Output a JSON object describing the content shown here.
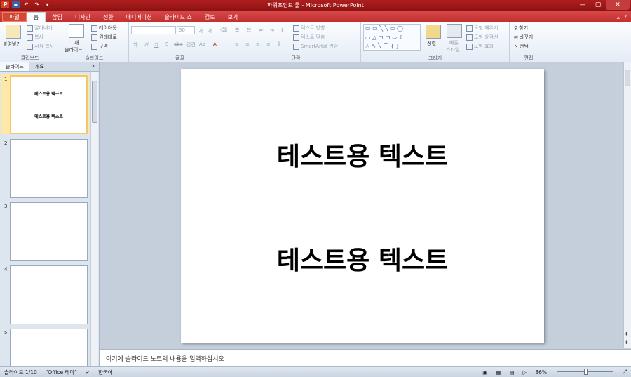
{
  "titlebar": {
    "title": "파워포인트 툴 - Microsoft PowerPoint",
    "qat": [
      "ppt-icon",
      "save-icon",
      "undo-icon",
      "redo-icon",
      "customize-icon"
    ]
  },
  "tabs": [
    "파일",
    "홈",
    "삽입",
    "디자인",
    "전환",
    "애니메이션",
    "슬라이드 쇼",
    "검토",
    "보기"
  ],
  "active_tab": "홈",
  "ribbon": {
    "clipboard": {
      "label": "클립보드",
      "paste": "붙여넣기",
      "cut": "잘라내기",
      "copy": "복사",
      "format_painter": "서식 복사"
    },
    "slides": {
      "label": "슬라이드",
      "new_slide_1": "새",
      "new_slide_2": "슬라이드",
      "layout": "레이아웃",
      "reset": "원래대로",
      "section": "구역"
    },
    "font": {
      "label": "글꼴",
      "size": "50",
      "bold": "가",
      "italic": "가",
      "underline": "가",
      "shadow": "S",
      "strike": "abc",
      "spacing": "간간",
      "case": "Aa",
      "grow": "가",
      "shrink": "가"
    },
    "paragraph": {
      "label": "단락",
      "text_direction": "텍스트 방향",
      "align_text": "텍스트 맞춤",
      "smartart": "SmartArt로 변환"
    },
    "drawing": {
      "label": "그리기",
      "arrange": "정렬",
      "quick_styles_1": "빠른",
      "quick_styles_2": "스타일",
      "fill": "도형 채우기",
      "outline": "도형 윤곽선",
      "effects": "도형 효과"
    },
    "editing": {
      "label": "편집",
      "find": "찾기",
      "replace": "바꾸기",
      "select": "선택"
    }
  },
  "panel": {
    "tab_slides": "슬라이드",
    "tab_outline": "개요",
    "close": "×"
  },
  "thumbnails": [
    {
      "num": "1",
      "line1": "테스트용 텍스트",
      "line2": "테스트용 텍스트"
    },
    {
      "num": "2"
    },
    {
      "num": "3"
    },
    {
      "num": "4"
    },
    {
      "num": "5"
    }
  ],
  "slide": {
    "line1": "테스트용 텍스트",
    "line2": "테스트용 텍스트"
  },
  "notes": {
    "placeholder": "여기에 슬라이드 노트의 내용을 입력하십시오"
  },
  "status": {
    "slide": "슬라이드 1/10",
    "theme": "\"Office 테마\"",
    "language": "한국어",
    "zoom": "86%"
  },
  "colors": {
    "titlebar": "#a01a1a",
    "ribbon": "#e4ecf6",
    "accent": "#d14836"
  }
}
